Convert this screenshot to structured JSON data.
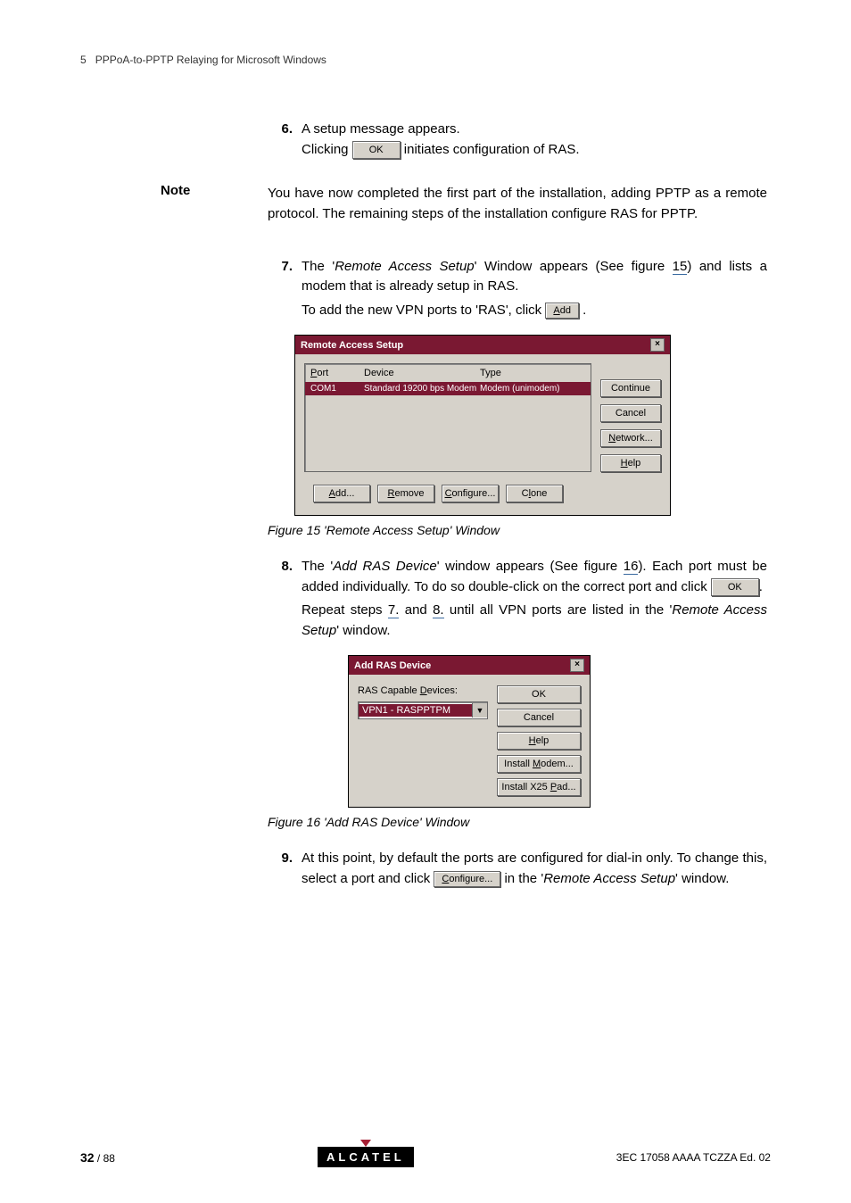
{
  "header": {
    "chapter_num": "5",
    "chapter_title": "PPPoA-to-PPTP Relaying for Microsoft Windows"
  },
  "note_label": "Note",
  "steps": {
    "s6": {
      "num": "6.",
      "line1": "A setup message appears.",
      "line2a": "Clicking ",
      "btn": "OK",
      "line2b": " initiates configuration of RAS."
    },
    "note_text": "You have now completed the first part of the installation, adding PPTP as a remote protocol. The remaining steps of the installation configure RAS for PPTP.",
    "s7": {
      "num": "7.",
      "line1a": "The '",
      "line1_it": "Remote Access Setup",
      "line1b": "' Window appears (See figure ",
      "figref": "15",
      "line1c": ") and lists a modem that is already setup in RAS.",
      "line2a": "To add the new VPN ports to 'RAS', click ",
      "btn": "Add",
      "line2b": "."
    },
    "s8": {
      "num": "8.",
      "line1a": "The '",
      "line1_it": "Add RAS Device",
      "line1b": "' window appears (See figure ",
      "figref": "16",
      "line1c": ").    Each port must be added individually. To do so double-click on the correct port and click ",
      "btn": "OK",
      "line1d": ".",
      "line2a": "Repeat steps ",
      "ref7": "7.",
      "line2b": " and ",
      "ref8": "8.",
      "line2c": " until all VPN ports are listed in the '",
      "line2_it": "Remote Access Setup",
      "line2d": "' window."
    },
    "s9": {
      "num": "9.",
      "line1a": "At this point, by default the ports are configured for dial-in only. To change this, select a port and click ",
      "btn": "Configure...",
      "line1b": " in the '",
      "line1_it": "Remote Access Setup",
      "line1c": "' window."
    }
  },
  "fig15": {
    "title": "Remote Access Setup",
    "cols": {
      "port": "Port",
      "device": "Device",
      "type": "Type"
    },
    "row": {
      "port": "COM1",
      "device": "Standard 19200 bps Modem",
      "type": "Modem (unimodem)"
    },
    "btns": {
      "continue": "Continue",
      "cancel": "Cancel",
      "network": "Network...",
      "help": "Help",
      "add": "Add...",
      "remove": "Remove",
      "configure": "Configure...",
      "clone": "Clone"
    },
    "caption": "Figure 15      'Remote Access Setup' Window"
  },
  "fig16": {
    "title": "Add RAS Device",
    "label": "RAS Capable Devices:",
    "value": "VPN1 - RASPPTPM",
    "btns": {
      "ok": "OK",
      "cancel": "Cancel",
      "help": "Help",
      "install_modem": "Install Modem...",
      "install_x25": "Install X25 Pad..."
    },
    "caption": "Figure 16      'Add RAS Device' Window"
  },
  "footer": {
    "page_cur": "32",
    "page_total": "/ 88",
    "logo": "ALCATEL",
    "doc_ref": "3EC 17058 AAAA TCZZA Ed. 02"
  }
}
